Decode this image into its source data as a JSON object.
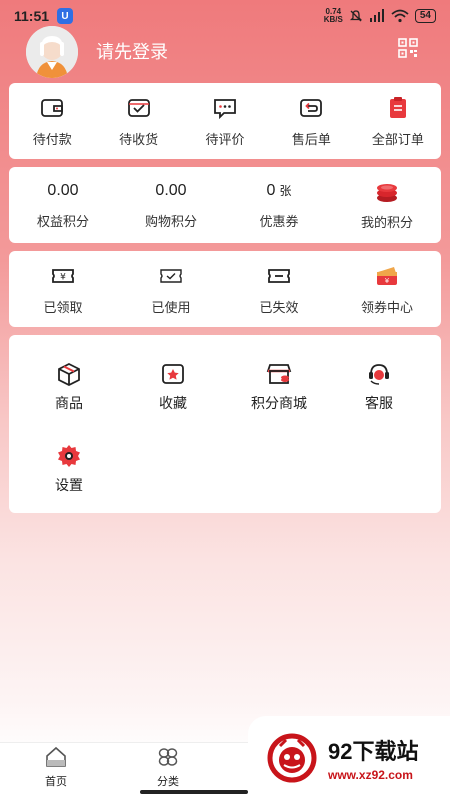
{
  "status_bar": {
    "time": "11:51",
    "app_badge": "U",
    "net_speed_value": "0.74",
    "net_speed_unit": "KB/S",
    "battery": "54"
  },
  "header": {
    "login_prompt": "请先登录"
  },
  "orders": {
    "items": [
      {
        "label": "待付款",
        "icon": "wallet-icon"
      },
      {
        "label": "待收货",
        "icon": "receive-box-icon"
      },
      {
        "label": "待评价",
        "icon": "comment-icon"
      },
      {
        "label": "售后单",
        "icon": "return-icon"
      },
      {
        "label": "全部订单",
        "icon": "clipboard-icon"
      }
    ]
  },
  "points": {
    "items": [
      {
        "value": "0.00",
        "unit": "",
        "label": "权益积分"
      },
      {
        "value": "0.00",
        "unit": "",
        "label": "购物积分"
      },
      {
        "value": "0",
        "unit": "张",
        "label": "优惠券"
      },
      {
        "value": "",
        "unit": "",
        "label": "我的积分",
        "icon": "coins-icon"
      }
    ]
  },
  "coupons": {
    "items": [
      {
        "label": "已领取",
        "icon": "coupon-yen-icon"
      },
      {
        "label": "已使用",
        "icon": "coupon-check-icon"
      },
      {
        "label": "已失效",
        "icon": "coupon-expired-icon"
      },
      {
        "label": "领券中心",
        "icon": "coupon-center-icon"
      }
    ]
  },
  "services": {
    "items": [
      {
        "label": "商品",
        "icon": "box-icon"
      },
      {
        "label": "收藏",
        "icon": "star-icon"
      },
      {
        "label": "积分商城",
        "icon": "store-icon"
      },
      {
        "label": "客服",
        "icon": "headset-icon"
      },
      {
        "label": "设置",
        "icon": "gear-icon"
      }
    ]
  },
  "tabbar": {
    "items": [
      {
        "label": "首页",
        "icon": "home-icon"
      },
      {
        "label": "分类",
        "icon": "category-icon"
      }
    ]
  },
  "watermark": {
    "title": "92下载站",
    "url": "www.xz92.com"
  },
  "colors": {
    "accent_red": "#e8393d",
    "header_pink": "#ef7a7c"
  }
}
